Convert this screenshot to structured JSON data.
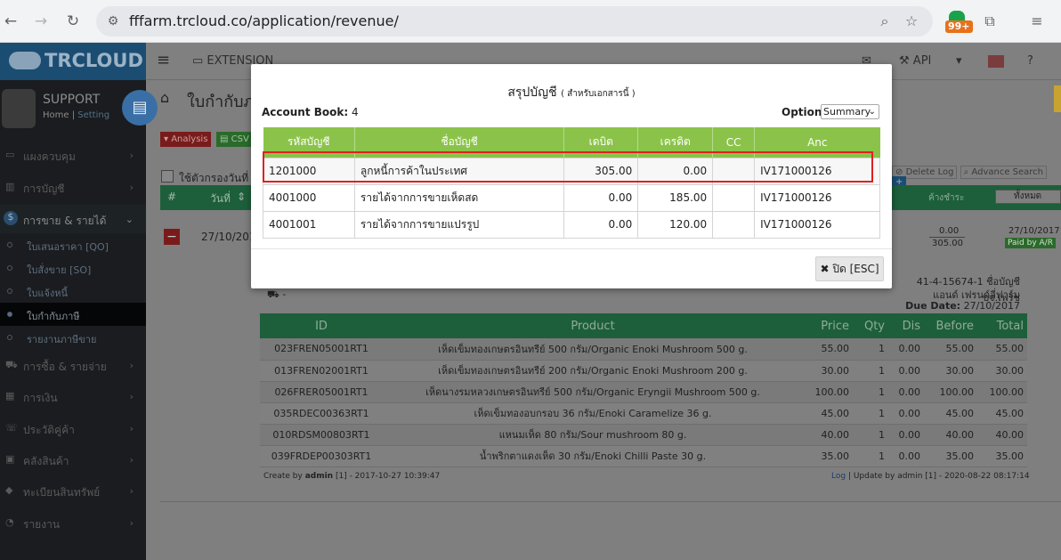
{
  "browser": {
    "url": "fffarm.trcloud.co/application/revenue/",
    "badge": "99+"
  },
  "app": {
    "logo": "TRCLOUD",
    "topbar": {
      "extension": "EXTENSION",
      "api": "API"
    },
    "user": {
      "name": "SUPPORT",
      "home": "Home",
      "setting": "Setting"
    },
    "sidebar": {
      "items": [
        {
          "label": "แผงควบคุม",
          "icon": "desktop-icon"
        },
        {
          "label": "การบัญชี",
          "icon": "book-icon"
        },
        {
          "label": "การขาย & รายได้",
          "icon": "dollar-icon"
        },
        {
          "label": "การซื้อ & รายจ่าย",
          "icon": "cart-icon"
        },
        {
          "label": "การเงิน",
          "icon": "calendar-icon"
        },
        {
          "label": "ประวัติคู่ค้า",
          "icon": "phone-icon"
        },
        {
          "label": "คลังสินค้า",
          "icon": "cubes-icon"
        },
        {
          "label": "ทะเบียนสินทรัพย์",
          "icon": "diamond-icon"
        },
        {
          "label": "รายงาน",
          "icon": "report-icon"
        }
      ],
      "subitems": [
        "ใบเสนอราคา [QO]",
        "ใบสั่งขาย [SO]",
        "ใบแจ้งหนี้",
        "ใบกำกับภาษี",
        "รายงานภาษีขาย"
      ]
    },
    "page_title": "ใบกำกับภ",
    "buttons": {
      "analysis": "Analysis",
      "csv": "CSV"
    },
    "filter_label": "ใช้ตัวกรองวันที่",
    "list_header": {
      "no": "#",
      "date": "วันที่"
    },
    "list_row": {
      "date": "27/10/2017"
    },
    "right_panel": {
      "delete_log": "Delete Log",
      "advanced_search": "Advance Search",
      "outstanding": "ค้างชำระ",
      "filter_all": "ทั้งหมด",
      "amount1": "0.00",
      "amount2": "305.00",
      "date": "27/10/2017",
      "status": "Paid by A/R"
    },
    "bank_info_1": "41-4-15674-1 ชื่อบัญชี บจ.เฟรช",
    "bank_info_2": "แอนด์ เฟรนด์ลี่ฟาร์ม",
    "due_date_label": "Due Date:",
    "due_date": "27/10/2017",
    "truck_text": "-",
    "product_table": {
      "headers": [
        "ID",
        "Product",
        "Price",
        "Qty",
        "Dis",
        "Before",
        "Total"
      ],
      "rows": [
        [
          "023FREN05001RT1",
          "เห็ดเข็มทองเกษตรอินทรีย์ 500 กรัม/Organic Enoki Mushroom 500 g.",
          "55.00",
          "1",
          "0.00",
          "55.00",
          "55.00"
        ],
        [
          "013FREN02001RT1",
          "เห็ดเข็มทองเกษตรอินทรีย์ 200 กรัม/Organic Enoki Mushroom 200 g.",
          "30.00",
          "1",
          "0.00",
          "30.00",
          "30.00"
        ],
        [
          "026FRER05001RT1",
          "เห็ดนางรมหลวงเกษตรอินทรีย์ 500 กรัม/Organic Eryngii Mushroom 500 g.",
          "100.00",
          "1",
          "0.00",
          "100.00",
          "100.00"
        ],
        [
          "035RDEC00363RT1",
          "เห็ดเข็มทองอบกรอบ 36 กรัม/Enoki Caramelize 36 g.",
          "45.00",
          "1",
          "0.00",
          "45.00",
          "45.00"
        ],
        [
          "010RDSM00803RT1",
          "แหนมเห็ด 80 กรัม/Sour mushroom 80 g.",
          "40.00",
          "1",
          "0.00",
          "40.00",
          "40.00"
        ],
        [
          "039FRDEP00303RT1",
          "น้ำพริกตาแดงเห็ด 30 กรัม/Enoki Chilli Paste 30 g.",
          "35.00",
          "1",
          "0.00",
          "35.00",
          "35.00"
        ]
      ]
    },
    "create_by": {
      "prefix": "Create by",
      "user": "admin",
      "rest": "[1] - 2017-10-27 10:39:47"
    },
    "update_by": {
      "log": "Log",
      "rest": "| Update by admin [1] - 2020-08-22 08:17:14"
    }
  },
  "modal": {
    "title": "สรุปบัญชี",
    "subtitle": "( สำหรับเอกสารนี้ )",
    "account_book_label": "Account Book:",
    "account_book_value": "4",
    "option_label": "Option:",
    "option_value": "Summary",
    "headers": [
      "รหัสบัญชี",
      "ชื่อบัญชี",
      "เดบิต",
      "เครดิต",
      "CC",
      "Anc"
    ],
    "rows": [
      {
        "code": "1201000",
        "name": "ลูกหนี้การค้าในประเทศ",
        "debit": "305.00",
        "credit": "0.00",
        "cc": "",
        "anc": "IV171000126"
      },
      {
        "code": "4001000",
        "name": "รายได้จากการขายเห็ดสด",
        "debit": "0.00",
        "credit": "185.00",
        "cc": "",
        "anc": "IV171000126"
      },
      {
        "code": "4001001",
        "name": "รายได้จากการขายแปรรูป",
        "debit": "0.00",
        "credit": "120.00",
        "cc": "",
        "anc": "IV171000126"
      }
    ],
    "close_label": "ปิด [ESC]"
  }
}
